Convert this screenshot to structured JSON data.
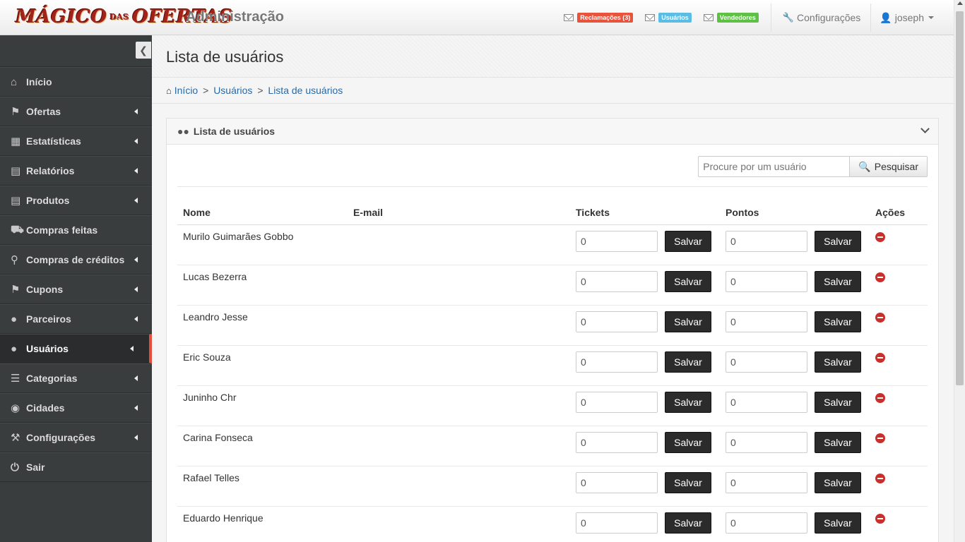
{
  "header": {
    "logo_text": "Mágico das Ofertas",
    "logo_part1": "MÁGICO",
    "logo_part2": "DAS",
    "logo_part3": "OFERTAS",
    "app_title": "Administração",
    "notifications": [
      {
        "label": "Reclamações (3)",
        "color": "#e8533c"
      },
      {
        "label": "Usuários",
        "color": "#5bbce4"
      },
      {
        "label": "Vendedores",
        "color": "#5fc046"
      }
    ],
    "settings_label": "Configurações",
    "user_name": "joseph"
  },
  "sidebar": {
    "items": [
      {
        "label": "Início",
        "icon": "home-icon",
        "has_arrow": false
      },
      {
        "label": "Ofertas",
        "icon": "bookmark-icon",
        "has_arrow": true
      },
      {
        "label": "Estatísticas",
        "icon": "bar-chart-icon",
        "has_arrow": true
      },
      {
        "label": "Relatórios",
        "icon": "file-icon",
        "has_arrow": true
      },
      {
        "label": "Produtos",
        "icon": "file-icon",
        "has_arrow": true
      },
      {
        "label": "Compras feitas",
        "icon": "truck-icon",
        "has_arrow": false
      },
      {
        "label": "Compras de créditos",
        "icon": "cart-icon",
        "has_arrow": true
      },
      {
        "label": "Cupons",
        "icon": "bookmark-icon",
        "has_arrow": true
      },
      {
        "label": "Parceiros",
        "icon": "user-icon",
        "has_arrow": true
      },
      {
        "label": "Usuários",
        "icon": "users-icon",
        "has_arrow": true,
        "active": true
      },
      {
        "label": "Categorias",
        "icon": "list-icon",
        "has_arrow": true
      },
      {
        "label": "Cidades",
        "icon": "globe-icon",
        "has_arrow": true
      },
      {
        "label": "Configurações",
        "icon": "wrench-icon",
        "has_arrow": true
      },
      {
        "label": "Sair",
        "icon": "power-icon",
        "has_arrow": false
      }
    ]
  },
  "main": {
    "page_title": "Lista de usuários",
    "breadcrumb": [
      "Início",
      "Usuários",
      "Lista de usuários"
    ],
    "panel_title": "Lista de usuários",
    "search": {
      "placeholder": "Procure por um usuário",
      "button_label": "Pesquisar"
    },
    "table": {
      "columns": [
        "Nome",
        "E-mail",
        "Tickets",
        "Pontos",
        "Ações"
      ],
      "save_label": "Salvar",
      "rows": [
        {
          "name": "Murilo Guimarães Gobbo",
          "email": "",
          "tickets": "0",
          "points": "0"
        },
        {
          "name": "Lucas Bezerra",
          "email": "",
          "tickets": "0",
          "points": "0"
        },
        {
          "name": "Leandro Jesse",
          "email": "",
          "tickets": "0",
          "points": "0"
        },
        {
          "name": "Eric Souza",
          "email": "",
          "tickets": "0",
          "points": "0"
        },
        {
          "name": "Juninho Chr",
          "email": "",
          "tickets": "0",
          "points": "0"
        },
        {
          "name": "Carina Fonseca",
          "email": "",
          "tickets": "0",
          "points": "0"
        },
        {
          "name": "Rafael Telles",
          "email": "",
          "tickets": "0",
          "points": "0"
        },
        {
          "name": "Eduardo Henrique",
          "email": "",
          "tickets": "0",
          "points": "0"
        }
      ]
    }
  },
  "colors": {
    "sidebar_bg": "#3a3d3e",
    "active_marker": "#e84c3d",
    "link": "#2a6aa5",
    "save_button": "#2b2b2b",
    "delete_icon": "#c9302c"
  }
}
